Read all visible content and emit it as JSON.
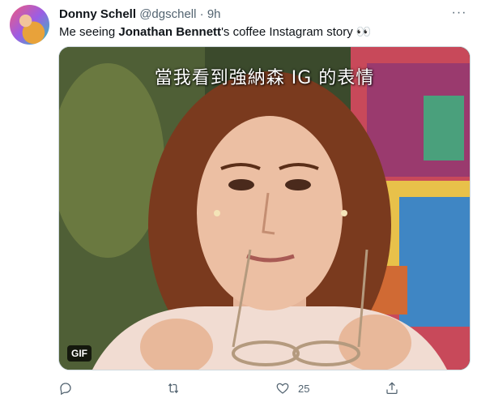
{
  "tweet": {
    "author_name": "Donny Schell",
    "handle": "@dgschell",
    "separator": "·",
    "time": "9h",
    "text_before": "Me seeing ",
    "text_bold": "Jonathan Bennett",
    "text_after": "'s coffee Instagram story 👀",
    "more_label": "···"
  },
  "media": {
    "caption": "當我看到強納森 IG 的表情",
    "badge": "GIF"
  },
  "actions": {
    "reply_count": "",
    "retweet_count": "",
    "like_count": "25",
    "share_count": ""
  },
  "icons": [
    "avatar",
    "more-icon",
    "reply-icon",
    "retweet-icon",
    "like-icon",
    "share-icon"
  ],
  "colors": {
    "text_secondary": "#536471",
    "text_primary": "#0f1419",
    "border": "#cfd9de"
  }
}
